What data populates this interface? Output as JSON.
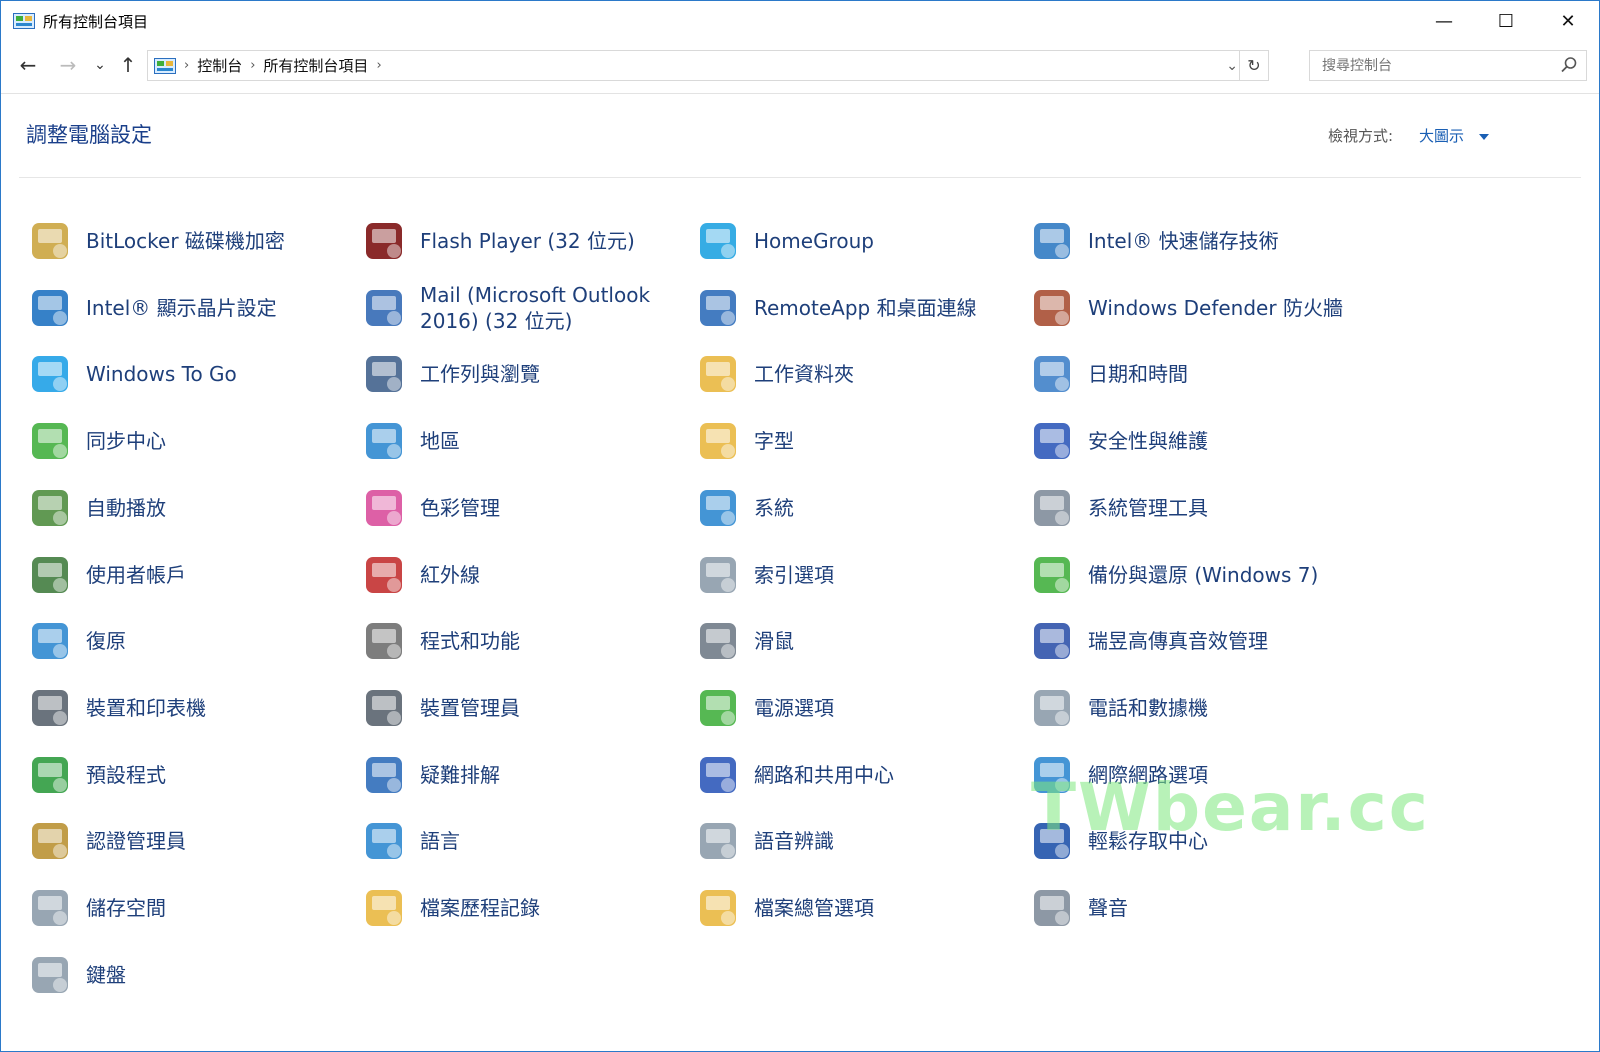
{
  "window": {
    "title": "所有控制台項目"
  },
  "controls": {
    "minimize": "—",
    "maximize": "☐",
    "close": "✕"
  },
  "nav": {
    "back": "←",
    "forward": "→",
    "recent": "⌄",
    "up": "↑"
  },
  "breadcrumb": [
    "控制台",
    "所有控制台項目"
  ],
  "search": {
    "placeholder": "搜尋控制台"
  },
  "header": {
    "title": "調整電腦設定",
    "view_label": "檢視方式:",
    "view_value": "大圖示"
  },
  "items": [
    {
      "label": "BitLocker 磁碟機加密",
      "icon": "bitlocker-icon",
      "color": "#c9a33b"
    },
    {
      "label": "Flash Player (32 位元)",
      "icon": "flash-icon",
      "color": "#7a0d0d"
    },
    {
      "label": "HomeGroup",
      "icon": "homegroup-icon",
      "color": "#1aa0e0"
    },
    {
      "label": "Intel® 快速儲存技術",
      "icon": "intel-storage-icon",
      "color": "#2b78c2"
    },
    {
      "label": "Intel® 顯示晶片設定",
      "icon": "intel-graphics-icon",
      "color": "#1a6fc0"
    },
    {
      "label": "Mail (Microsoft Outlook 2016) (32 位元)",
      "icon": "mail-icon",
      "color": "#2f67b3"
    },
    {
      "label": "RemoteApp 和桌面連線",
      "icon": "remoteapp-icon",
      "color": "#2a6ab8"
    },
    {
      "label": "Windows Defender 防火牆",
      "icon": "firewall-icon",
      "color": "#a64a2f"
    },
    {
      "label": "Windows To Go",
      "icon": "windows-to-go-icon",
      "color": "#1a9ee6"
    },
    {
      "label": "工作列與瀏覽",
      "icon": "taskbar-icon",
      "color": "#3d5f8a"
    },
    {
      "label": "工作資料夾",
      "icon": "work-folders-icon",
      "color": "#e8b63c"
    },
    {
      "label": "日期和時間",
      "icon": "date-time-icon",
      "color": "#3b7ec7"
    },
    {
      "label": "同步中心",
      "icon": "sync-icon",
      "color": "#3fae3b"
    },
    {
      "label": "地區",
      "icon": "region-icon",
      "color": "#2a86cf"
    },
    {
      "label": "字型",
      "icon": "fonts-icon",
      "color": "#e8b63c"
    },
    {
      "label": "安全性與維護",
      "icon": "flag-icon",
      "color": "#2a55b8"
    },
    {
      "label": "自動播放",
      "icon": "autoplay-icon",
      "color": "#4b8b3b"
    },
    {
      "label": "色彩管理",
      "icon": "color-management-icon",
      "color": "#d84a9a"
    },
    {
      "label": "系統",
      "icon": "system-icon",
      "color": "#2a86cf"
    },
    {
      "label": "系統管理工具",
      "icon": "admin-tools-icon",
      "color": "#7d8a99"
    },
    {
      "label": "使用者帳戶",
      "icon": "user-accounts-icon",
      "color": "#3d7a3b"
    },
    {
      "label": "紅外線",
      "icon": "infrared-icon",
      "color": "#c22b2b"
    },
    {
      "label": "索引選項",
      "icon": "indexing-icon",
      "color": "#8a9aa8"
    },
    {
      "label": "備份與還原 (Windows 7)",
      "icon": "backup-icon",
      "color": "#3fae3b"
    },
    {
      "label": "復原",
      "icon": "recovery-icon",
      "color": "#2a86cf"
    },
    {
      "label": "程式和功能",
      "icon": "programs-icon",
      "color": "#6b6b6b"
    },
    {
      "label": "滑鼠",
      "icon": "mouse-icon",
      "color": "#6d7985"
    },
    {
      "label": "瑞昱高傳真音效管理",
      "icon": "realtek-audio-icon",
      "color": "#2a4fa8"
    },
    {
      "label": "裝置和印表機",
      "icon": "devices-printers-icon",
      "color": "#55606b"
    },
    {
      "label": "裝置管理員",
      "icon": "device-manager-icon",
      "color": "#55606b"
    },
    {
      "label": "電源選項",
      "icon": "power-icon",
      "color": "#3fae3b"
    },
    {
      "label": "電話和數據機",
      "icon": "phone-modem-icon",
      "color": "#8a9aa8"
    },
    {
      "label": "預設程式",
      "icon": "default-programs-icon",
      "color": "#2a9a3b"
    },
    {
      "label": "疑難排解",
      "icon": "troubleshooting-icon",
      "color": "#2a6ab8"
    },
    {
      "label": "網路和共用中心",
      "icon": "network-icon",
      "color": "#2a55b8"
    },
    {
      "label": "網際網路選項",
      "icon": "internet-options-icon",
      "color": "#2a86cf"
    },
    {
      "label": "認證管理員",
      "icon": "credential-manager-icon",
      "color": "#b8902f"
    },
    {
      "label": "語言",
      "icon": "language-icon",
      "color": "#2a86cf"
    },
    {
      "label": "語音辨識",
      "icon": "speech-icon",
      "color": "#8a9aa8"
    },
    {
      "label": "輕鬆存取中心",
      "icon": "ease-of-access-icon",
      "color": "#1a4fa8"
    },
    {
      "label": "儲存空間",
      "icon": "storage-spaces-icon",
      "color": "#8a9aa8"
    },
    {
      "label": "檔案歷程記錄",
      "icon": "file-history-icon",
      "color": "#e8b63c"
    },
    {
      "label": "檔案總管選項",
      "icon": "folder-options-icon",
      "color": "#e8b63c"
    },
    {
      "label": "聲音",
      "icon": "sound-icon",
      "color": "#7d8a99"
    },
    {
      "label": "鍵盤",
      "icon": "keyboard-icon",
      "color": "#8a9aa8"
    }
  ],
  "watermark": "TWbear.cc"
}
